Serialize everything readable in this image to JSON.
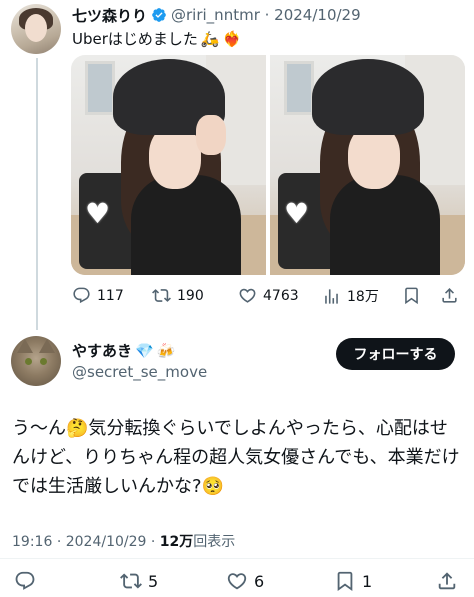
{
  "tweet1": {
    "display_name": "七ツ森りり",
    "handle": "@riri_nntmr",
    "date": "2024/10/29",
    "text": "Uberはじめました",
    "emojis": [
      "🛵",
      "❤️‍🔥"
    ],
    "stats": {
      "replies": "117",
      "retweets": "190",
      "likes": "4763",
      "views": "18万"
    }
  },
  "tweet2": {
    "display_name": "やすあき",
    "name_emojis": [
      "💎",
      "🍻"
    ],
    "handle": "@secret_se_move",
    "follow_label": "フォローする",
    "text_parts": [
      "う〜ん",
      "🤔",
      "気分転換ぐらいでしよんやったら、心配はせんけど、りりちゃん程の超人気女優さんでも、本業だけでは生活厳しいんかな?",
      "🥺"
    ],
    "time": "19:16",
    "date": "2024/10/29",
    "views_value": "12万",
    "views_label": "回表示",
    "stats": {
      "retweets": "5",
      "likes": "6",
      "bookmarks": "1"
    }
  },
  "colors": {
    "text": "#0f1419",
    "muted": "#536471",
    "verified": "#1d9bf0",
    "button_bg": "#0f1419"
  }
}
